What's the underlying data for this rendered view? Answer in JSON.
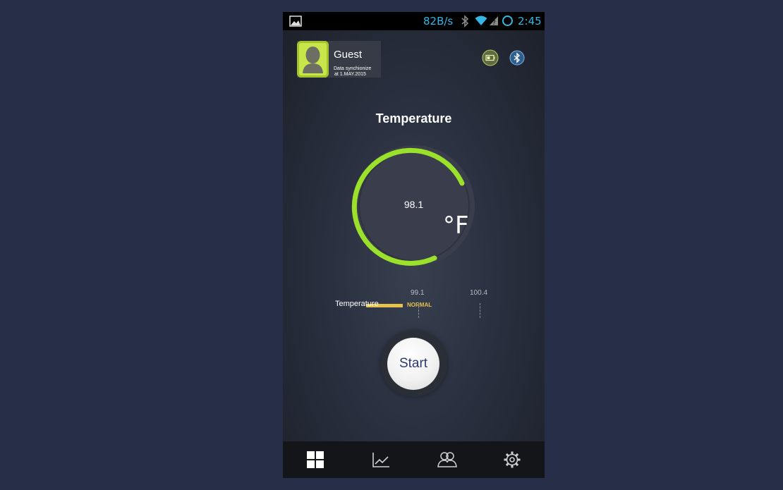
{
  "status_bar": {
    "net_speed": "82B/s",
    "time": "2:45",
    "icons": [
      "gallery-icon",
      "bluetooth-icon",
      "wifi-icon",
      "signal-icon",
      "sync-icon"
    ],
    "icon_color": "#33b5e5"
  },
  "profile": {
    "name": "Guest",
    "sync_line1": "Data synchionize",
    "sync_line2": "at 1.MAY.2015",
    "avatar_color": "#c6e64a"
  },
  "header_icons": [
    "battery-icon",
    "bluetooth-icon"
  ],
  "page": {
    "title": "Temperature"
  },
  "gauge": {
    "value": "98.1",
    "unit": "°F",
    "arc_color": "#9be02a"
  },
  "scale": {
    "label": "Temperature",
    "status": "NORMAL",
    "status_color": "#e8c14a",
    "tick1": "99.1",
    "tick2": "100.4"
  },
  "start_button": {
    "label": "Start"
  },
  "tab_bar": {
    "tabs": [
      {
        "name": "dashboard",
        "icon": "grid-icon",
        "active": true
      },
      {
        "name": "history",
        "icon": "line-chart-icon",
        "active": false
      },
      {
        "name": "users",
        "icon": "users-icon",
        "active": false
      },
      {
        "name": "settings",
        "icon": "gear-icon",
        "active": false
      }
    ]
  }
}
